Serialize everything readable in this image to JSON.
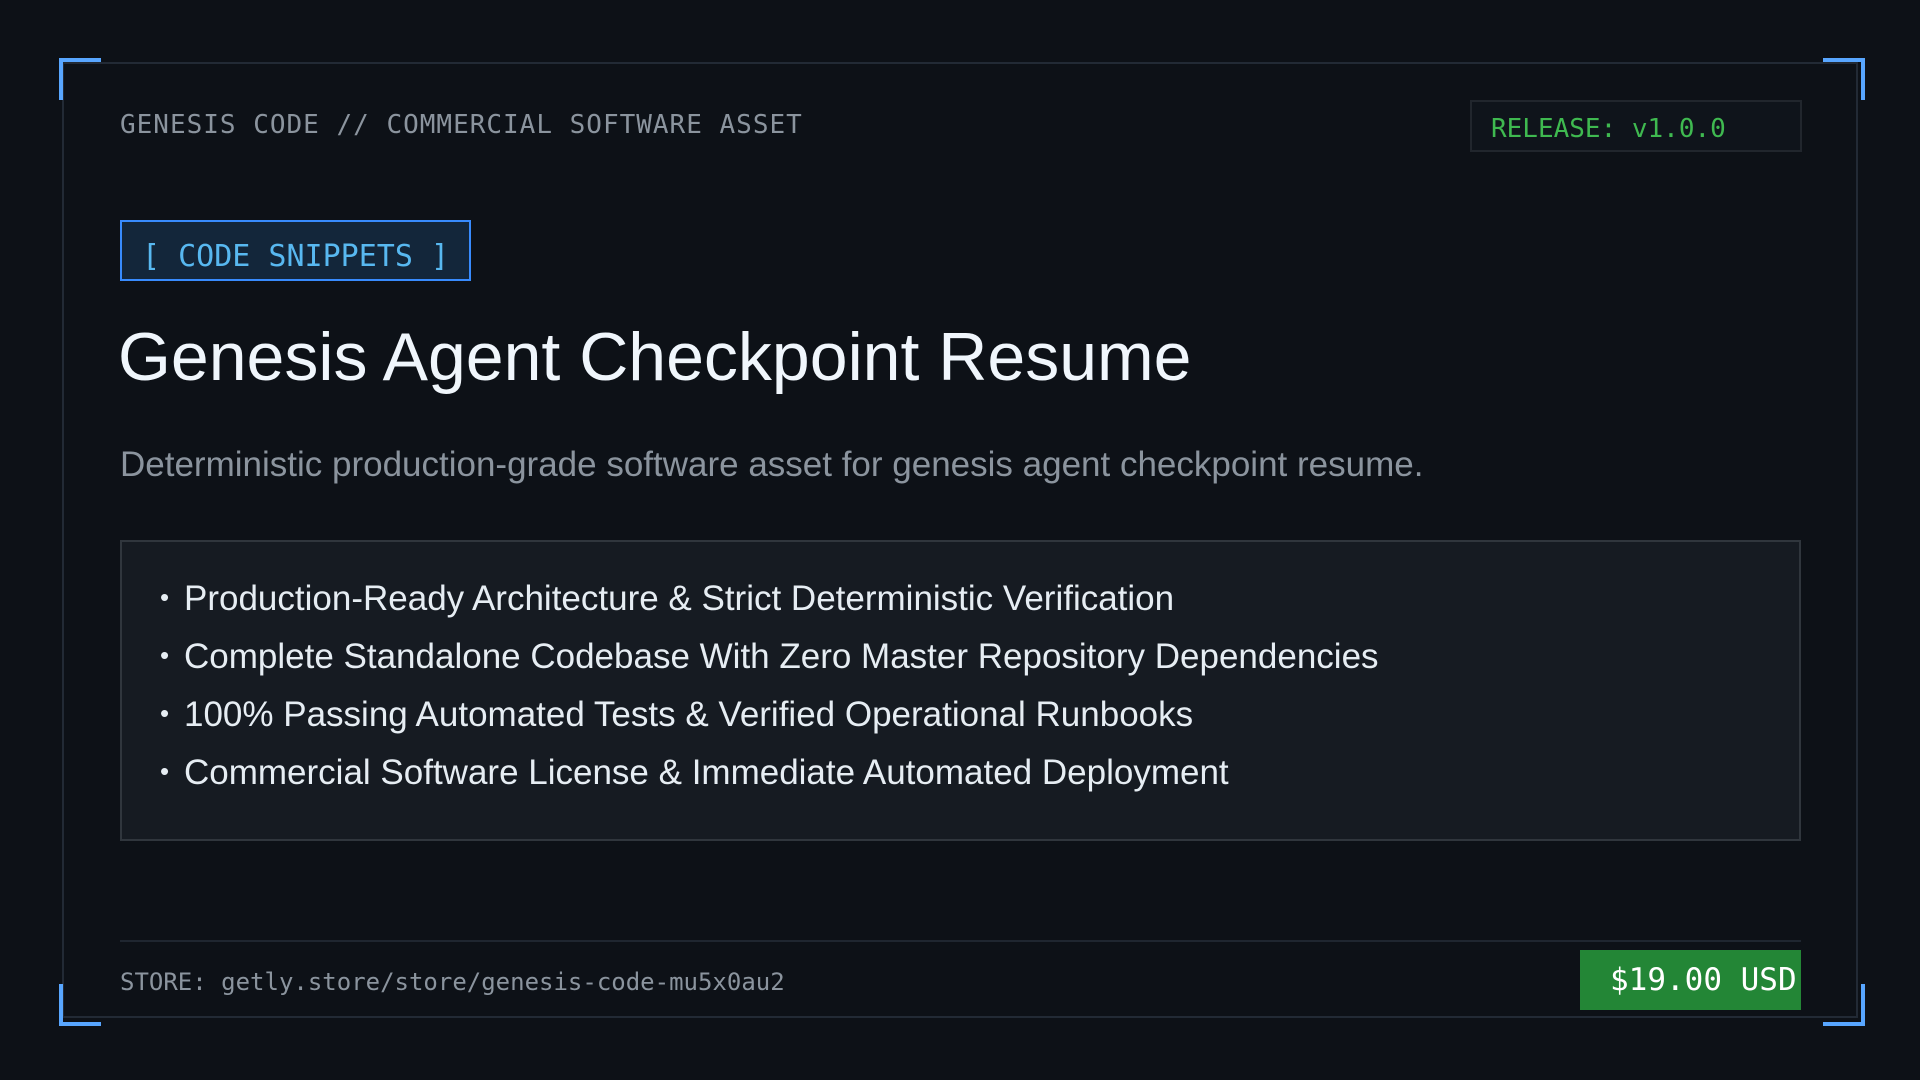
{
  "header": {
    "label": "GENESIS CODE // COMMERCIAL SOFTWARE ASSET",
    "release": "RELEASE: v1.0.0"
  },
  "product": {
    "category": "[ CODE SNIPPETS ]",
    "title": "Genesis Agent Checkpoint Resume",
    "subtitle": "Deterministic production-grade software asset for genesis agent checkpoint resume.",
    "bullet_glyph": "•",
    "features": [
      "Production-Ready Architecture & Strict Deterministic Verification",
      "Complete Standalone Codebase With Zero Master Repository Dependencies",
      "100% Passing Automated Tests & Verified Operational Runbooks",
      "Commercial Software License & Immediate Automated Deployment"
    ]
  },
  "footer": {
    "store": "STORE: getly.store/store/genesis-code-mu5x0au2",
    "price": "$19.00 USD"
  },
  "colors": {
    "background": "#0d1117",
    "accent_blue": "#58a6ff",
    "release_green": "#3fb950",
    "price_green": "#238636"
  }
}
